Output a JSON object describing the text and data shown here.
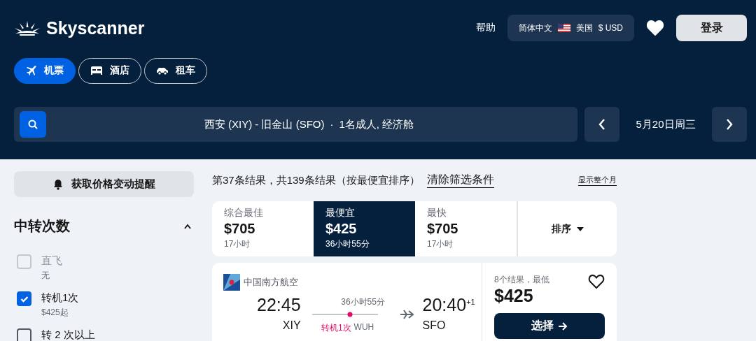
{
  "header": {
    "logo": "Skyscanner",
    "help": "帮助",
    "locale": {
      "language": "简体中文",
      "country": "美国",
      "currency": "$ USD"
    },
    "login": "登录"
  },
  "nav_tabs": [
    {
      "label": "机票",
      "kind": "flights",
      "selected": true
    },
    {
      "label": "酒店",
      "kind": "hotels",
      "selected": false
    },
    {
      "label": "租车",
      "kind": "cars",
      "selected": false
    }
  ],
  "search": {
    "route": "西安 (XIY) - 旧金山 (SFO)",
    "separator": "·",
    "passengers": "1名成人, 经济舱",
    "date": "5月20日周三"
  },
  "sidebar": {
    "alert_button": "获取价格变动提醒",
    "filter": {
      "title": "中转次数",
      "expanded": true,
      "options": [
        {
          "label": "直飞",
          "note": "无",
          "checked": false,
          "disabled": true
        },
        {
          "label": "转机1次",
          "note": "$425起",
          "checked": true,
          "disabled": false
        },
        {
          "label": "转 2 次以上",
          "checked": false,
          "disabled": false
        }
      ]
    }
  },
  "results": {
    "summary": "第37条结果，共139条结果（按最便宜排序）",
    "clear_filters": "清除筛选条件",
    "show_month": "显示整个月",
    "sort_tabs": [
      {
        "label": "综合最佳",
        "price": "$705",
        "duration": "17小时",
        "selected": false
      },
      {
        "label": "最便宜",
        "price": "$425",
        "duration": "36小时55分",
        "selected": true
      },
      {
        "label": "最快",
        "price": "$705",
        "duration": "17小时",
        "selected": false
      }
    ],
    "sort_button": "排序",
    "card": {
      "airline": "中国南方航空",
      "depart_time": "22:45",
      "depart_code": "XIY",
      "duration": "36小时55分",
      "stops": "转机1次",
      "via": "WUH",
      "arrive_time": "20:40",
      "day_offset": "+1",
      "arrive_code": "SFO",
      "deals": "8个结果，最低",
      "price": "$425",
      "saved": false,
      "select": "选择"
    }
  }
}
